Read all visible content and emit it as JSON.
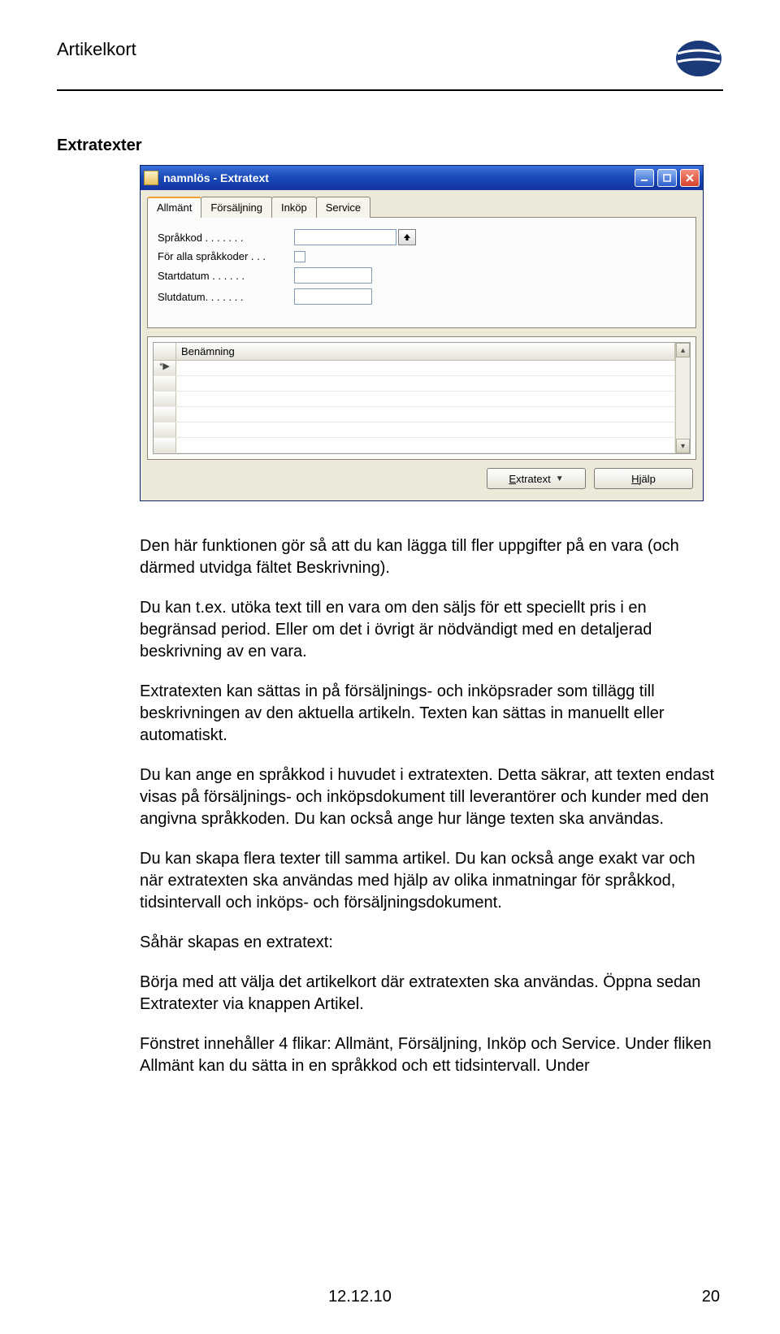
{
  "page": {
    "header_title": "Artikelkort",
    "section_title": "Extratexter",
    "footer_date": "12.12.10",
    "page_number": "20"
  },
  "window": {
    "title": "namnlös - Extratext",
    "tabs": [
      "Allmänt",
      "Försäljning",
      "Inköp",
      "Service"
    ],
    "fields": {
      "sprakkod_label": "Språkkod . . . . . . .",
      "for_alla_label": "För alla språkkoder  .  .  .",
      "startdatum_label": "Startdatum . . . . . .",
      "slutdatum_label": "Slutdatum. . . . . . .",
      "sprakkod_value": "",
      "startdatum_value": "",
      "slutdatum_value": ""
    },
    "grid_header": "Benämning",
    "grid_new_marker": "*▶",
    "buttons": {
      "extratext": "xtratext",
      "extratext_u": "E",
      "hjalp": "jälp",
      "hjalp_u": "H"
    }
  },
  "body": {
    "p1": "Den här funktionen gör så att du kan lägga till fler uppgifter på en vara (och därmed utvidga fältet Beskrivning).",
    "p2": "Du kan t.ex. utöka text till en vara om den säljs för ett speciellt pris i en begränsad period. Eller om det i övrigt är nödvändigt med en detaljerad beskrivning av en vara.",
    "p3": "Extratexten kan sättas in på försäljnings- och inköpsrader som tillägg till beskrivningen av den aktuella artikeln. Texten kan sättas in manuellt eller automatiskt.",
    "p4": "Du kan ange en språkkod i huvudet i extratexten. Detta säkrar, att texten endast visas på försäljnings- och inköpsdokument till leverantörer och kunder med den angivna språkkoden. Du kan också ange hur länge texten ska användas.",
    "p5": "Du kan skapa flera texter till samma artikel. Du kan också ange exakt var och när extratexten ska användas med hjälp av olika inmatningar för språkkod, tidsintervall och inköps- och försäljningsdokument.",
    "p6": "Såhär skapas en extratext:",
    "p7": "Börja med att välja det artikelkort där extratexten ska användas. Öppna sedan Extratexter via knappen Artikel.",
    "p8": "Fönstret innehåller 4 flikar: Allmänt, Försäljning, Inköp och Service. Under fliken Allmänt kan du sätta in en språkkod och ett tidsintervall. Under"
  }
}
